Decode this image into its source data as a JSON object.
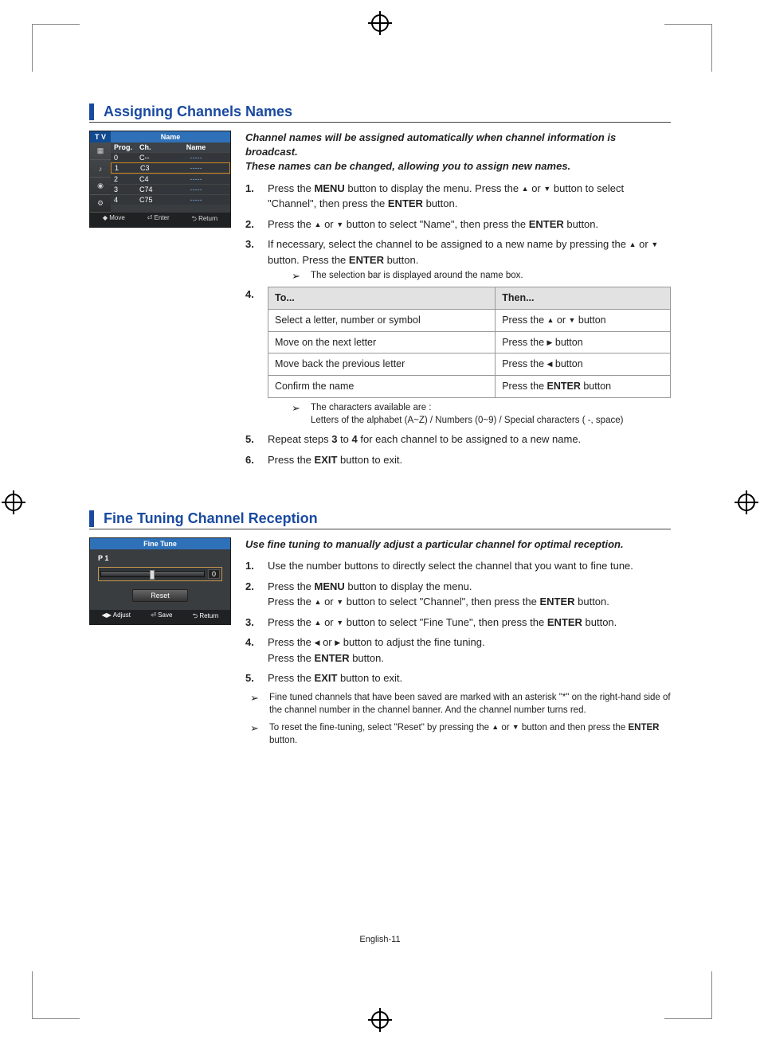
{
  "page_number_label": "English-11",
  "sections": [
    {
      "title": "Assigning Channels Names",
      "intro": "Channel names will be assigned automatically when channel information is broadcast.\nThese names can be changed, allowing you to assign new names.",
      "osd": {
        "side_label": "T V",
        "title": "Name",
        "headers": [
          "Prog.",
          "Ch.",
          "Name"
        ],
        "rows": [
          {
            "prog": "0",
            "ch": "C--",
            "name": "-----",
            "selected": false
          },
          {
            "prog": "1",
            "ch": "C3",
            "name": "-----",
            "selected": true
          },
          {
            "prog": "2",
            "ch": "C4",
            "name": "-----",
            "selected": false
          },
          {
            "prog": "3",
            "ch": "C74",
            "name": "-----",
            "selected": false
          },
          {
            "prog": "4",
            "ch": "C75",
            "name": "-----",
            "selected": false
          }
        ],
        "footer": [
          "◆ Move",
          "⏎ Enter",
          "⮌ Return"
        ]
      },
      "steps": [
        "Press the <b>MENU</b> button to display the menu.  Press the <span class='tri'>▲</span> or <span class='tri'>▼</span> button to select \"Channel\", then press the <b>ENTER</b> button.",
        "Press the <span class='tri'>▲</span> or <span class='tri'>▼</span> button to select \"Name\", then press the <b>ENTER</b> button.",
        "If necessary, select the channel to be assigned to a new name by pressing the <span class='tri'>▲</span> or <span class='tri'>▼</span> button. Press the <b>ENTER</b> button.",
        "__TABLE__",
        "Repeat steps <b>3</b> to <b>4</b> for each channel to be assigned to a new name.",
        "Press the <b>EXIT</b> button to exit."
      ],
      "step3_note": "The selection bar is displayed around the name box.",
      "table": {
        "h1": "To...",
        "h2": "Then...",
        "rows": [
          [
            "Select a letter, number or symbol",
            "Press the <span class='tri'>▲</span> or <span class='tri'>▼</span> button"
          ],
          [
            "Move on the next letter",
            "Press the <span class='tri'>▶</span> button"
          ],
          [
            "Move back the previous letter",
            "Press the <span class='tri'>◀</span> button"
          ],
          [
            "Confirm the name",
            "Press the <b>ENTER</b> button"
          ]
        ]
      },
      "table_note_1": "The characters available are :",
      "table_note_2": "Letters of the alphabet (A~Z) / Numbers (0~9) / Special characters ( -, space)"
    },
    {
      "title": "Fine Tuning Channel Reception",
      "intro": "Use fine tuning to manually adjust a particular channel for optimal reception.",
      "osd": {
        "title": "Fine Tune",
        "channel": "P 1",
        "value": "0",
        "reset": "Reset",
        "footer": [
          "◀▶ Adjust",
          "⏎ Save",
          "⮌ Return"
        ]
      },
      "steps": [
        "Use the number buttons to directly select the channel that you want to fine tune.",
        "Press the <b>MENU</b> button to display the menu.<br>Press the <span class='tri'>▲</span> or <span class='tri'>▼</span> button to select \"Channel\", then press the <b>ENTER</b> button.",
        "Press the <span class='tri'>▲</span> or <span class='tri'>▼</span> button to select \"Fine Tune\", then press the <b>ENTER</b> button.",
        "Press the <span class='tri'>◀</span> or <span class='tri'>▶</span> button to adjust the fine tuning.<br>Press the <b>ENTER</b> button.",
        "Press the <b>EXIT</b> button to exit."
      ],
      "end_notes": [
        "Fine tuned channels that have been saved are marked with an asterisk \"*\" on the right-hand side of the channel number in the channel banner.  And the channel number turns red.",
        "To reset the fine-tuning, select \"Reset\" by pressing the <span class='tri'>▲</span> or <span class='tri'>▼</span> button and then press the <b>ENTER</b> button."
      ]
    }
  ],
  "chart_data": {
    "type": "table",
    "title": "Channel name editing actions",
    "categories": [
      "Select a letter, number or symbol",
      "Move on the next letter",
      "Move back the previous letter",
      "Confirm the name"
    ],
    "values": [
      "Press the ▲ or ▼ button",
      "Press the ▶ button",
      "Press the ◀ button",
      "Press the ENTER button"
    ]
  }
}
